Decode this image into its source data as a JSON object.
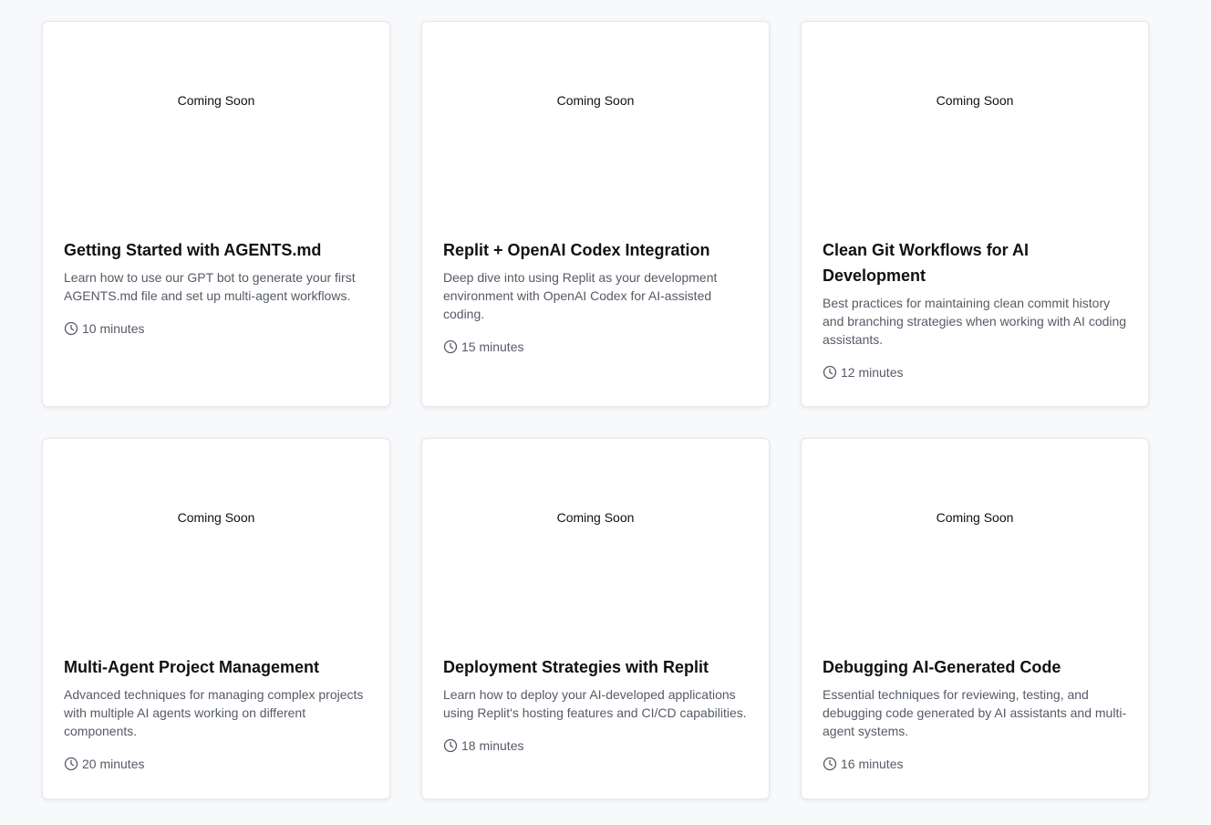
{
  "cards": [
    {
      "placeholder": "Coming Soon",
      "title": "Getting Started with AGENTS.md",
      "description": "Learn how to use our GPT bot to generate your first AGENTS.md file and set up multi-agent workflows.",
      "duration": "10 minutes",
      "icon": "clock-icon"
    },
    {
      "placeholder": "Coming Soon",
      "title": "Replit + OpenAI Codex Integration",
      "description": "Deep dive into using Replit as your development environment with OpenAI Codex for AI-assisted coding.",
      "duration": "15 minutes",
      "icon": "clock-icon"
    },
    {
      "placeholder": "Coming Soon",
      "title": "Clean Git Workflows for AI Development",
      "description": "Best practices for maintaining clean commit history and branching strategies when working with AI coding assistants.",
      "duration": "12 minutes",
      "icon": "clock-icon"
    },
    {
      "placeholder": "Coming Soon",
      "title": "Multi-Agent Project Management",
      "description": "Advanced techniques for managing complex projects with multiple AI agents working on different components.",
      "duration": "20 minutes",
      "icon": "clock-icon"
    },
    {
      "placeholder": "Coming Soon",
      "title": "Deployment Strategies with Replit",
      "description": "Learn how to deploy your AI-developed applications using Replit's hosting features and CI/CD capabilities.",
      "duration": "18 minutes",
      "icon": "clock-icon"
    },
    {
      "placeholder": "Coming Soon",
      "title": "Debugging AI-Generated Code",
      "description": "Essential techniques for reviewing, testing, and debugging code generated by AI assistants and multi-agent systems.",
      "duration": "16 minutes",
      "icon": "clock-icon"
    }
  ]
}
